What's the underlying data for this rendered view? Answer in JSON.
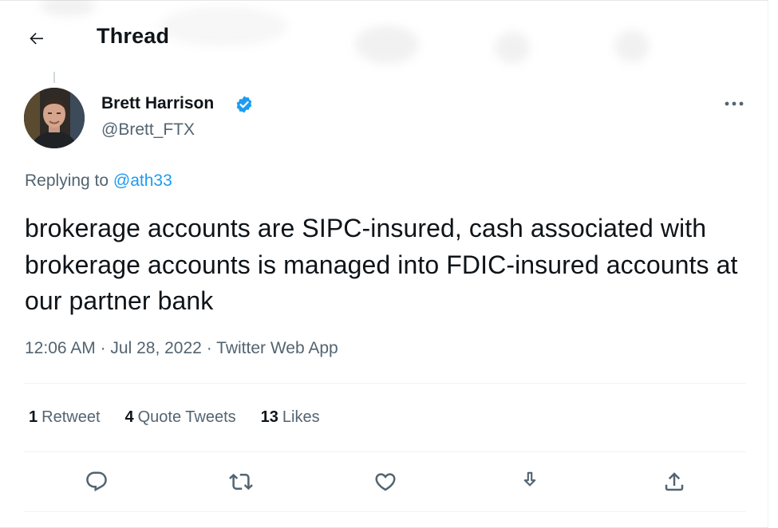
{
  "header": {
    "title": "Thread"
  },
  "author": {
    "name": "Brett Harrison",
    "handle": "@Brett_FTX"
  },
  "reply": {
    "prefix": "Replying to",
    "mention": "@ath33"
  },
  "tweet": {
    "text": "brokerage accounts are SIPC-insured, cash associated with brokerage accounts is managed into FDIC-insured accounts at our partner bank"
  },
  "meta": {
    "time": "12:06 AM",
    "date": "Jul 28, 2022",
    "source": "Twitter Web App",
    "separator": "·"
  },
  "stats": [
    {
      "count": "1",
      "label": "Retweet"
    },
    {
      "count": "4",
      "label": "Quote Tweets"
    },
    {
      "count": "13",
      "label": "Likes"
    }
  ],
  "icons": {
    "back": "arrow-left-icon",
    "verified": "verified-badge-icon",
    "more": "more-horizontal-icon",
    "reply": "reply-icon",
    "retweet": "retweet-icon",
    "like": "heart-icon",
    "bookmark": "bookmark-icon",
    "share": "share-icon"
  },
  "colors": {
    "accent": "#1d9bf0",
    "text": "#0f1419",
    "secondary": "#536471",
    "divider": "#eff3f4"
  }
}
